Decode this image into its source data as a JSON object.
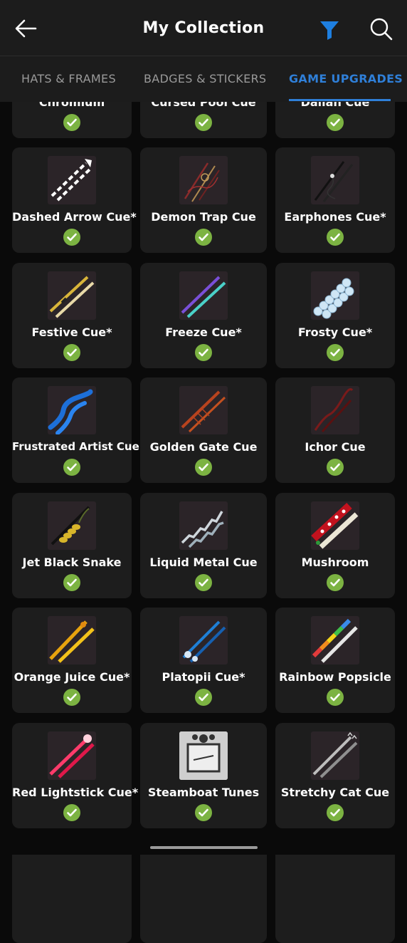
{
  "header": {
    "title": "My Collection"
  },
  "tabs": [
    {
      "label": "HATS & FRAMES"
    },
    {
      "label": "BADGES & STICKERS"
    },
    {
      "label": "GAME UPGRADES"
    }
  ],
  "colors": {
    "accent": "#2f7fd8",
    "check": "#7cb342",
    "card": "#1d1d1d"
  },
  "items": [
    {
      "name": "Chromium",
      "owned": true
    },
    {
      "name": "Cursed Pool Cue",
      "owned": true
    },
    {
      "name": "Dallah Cue",
      "owned": true
    },
    {
      "name": "Dashed Arrow Cue*",
      "owned": true
    },
    {
      "name": "Demon Trap Cue",
      "owned": true
    },
    {
      "name": "Earphones Cue*",
      "owned": true
    },
    {
      "name": "Festive Cue*",
      "owned": true
    },
    {
      "name": "Freeze Cue*",
      "owned": true
    },
    {
      "name": "Frosty Cue*",
      "owned": true
    },
    {
      "name": "Frustrated Artist Cue",
      "owned": true
    },
    {
      "name": "Golden Gate Cue",
      "owned": true
    },
    {
      "name": "Ichor Cue",
      "owned": true
    },
    {
      "name": "Jet Black Snake",
      "owned": true
    },
    {
      "name": "Liquid Metal Cue",
      "owned": true
    },
    {
      "name": "Mushroom",
      "owned": true
    },
    {
      "name": "Orange Juice Cue*",
      "owned": true
    },
    {
      "name": "Platopii Cue*",
      "owned": true
    },
    {
      "name": "Rainbow Popsicle",
      "owned": true
    },
    {
      "name": "Red Lightstick Cue*",
      "owned": true
    },
    {
      "name": "Steamboat Tunes",
      "owned": true
    },
    {
      "name": "Stretchy Cat Cue",
      "owned": true
    }
  ]
}
